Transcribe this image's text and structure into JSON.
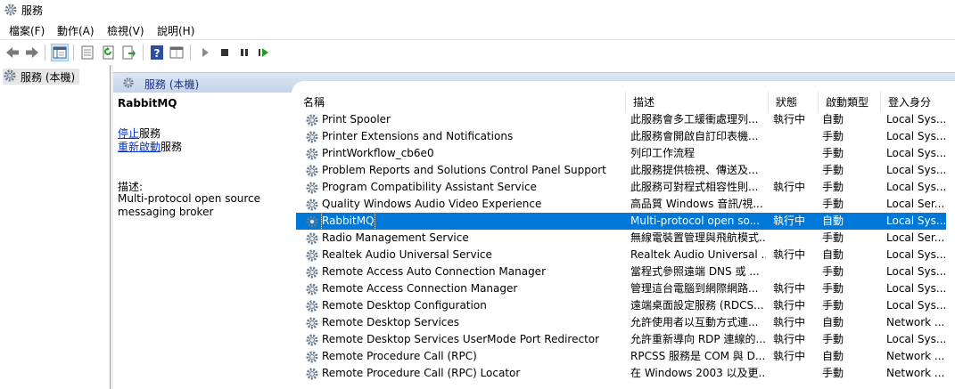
{
  "window": {
    "title": "服務"
  },
  "menu": [
    "檔案(F)",
    "動作(A)",
    "檢視(V)",
    "說明(H)"
  ],
  "tree": {
    "node_label": "服務 (本機)"
  },
  "detail_header": {
    "title": "服務 (本機)"
  },
  "selected_service": {
    "name": "RabbitMQ",
    "stop_link": "停止",
    "stop_suffix": "服務",
    "restart_link": "重新啟動",
    "restart_suffix": "服務",
    "desc_label": "描述:",
    "desc_text": "Multi-protocol open source messaging broker"
  },
  "columns": [
    "名稱",
    "描述",
    "狀態",
    "啟動類型",
    "登入身分"
  ],
  "rows": [
    {
      "name": "Print Spooler",
      "desc": "此服務會多工緩衝處理列...",
      "status": "執行中",
      "startup": "自動",
      "logon": "Local Sys..."
    },
    {
      "name": "Printer Extensions and Notifications",
      "desc": "此服務會開啟自訂印表機...",
      "status": "",
      "startup": "手動",
      "logon": "Local Sys..."
    },
    {
      "name": "PrintWorkflow_cb6e0",
      "desc": "列印工作流程",
      "status": "",
      "startup": "手動",
      "logon": "Local Sys..."
    },
    {
      "name": "Problem Reports and Solutions Control Panel Support",
      "desc": "此服務提供檢視、傳送及...",
      "status": "",
      "startup": "手動",
      "logon": "Local Sys..."
    },
    {
      "name": "Program Compatibility Assistant Service",
      "desc": "此服務可對程式相容性則...",
      "status": "執行中",
      "startup": "手動",
      "logon": "Local Sys..."
    },
    {
      "name": "Quality Windows Audio Video Experience",
      "desc": "高品質 Windows 音訊/視...",
      "status": "",
      "startup": "手動",
      "logon": "Local Ser..."
    },
    {
      "name": "RabbitMQ",
      "desc": "Multi-protocol open so...",
      "status": "執行中",
      "startup": "自動",
      "logon": "Local Sys..."
    },
    {
      "name": "Radio Management Service",
      "desc": "無線電裝置管理與飛航模式...",
      "status": "",
      "startup": "手動",
      "logon": "Local Ser..."
    },
    {
      "name": "Realtek Audio Universal Service",
      "desc": "Realtek Audio Universal ...",
      "status": "執行中",
      "startup": "自動",
      "logon": "Local Sys..."
    },
    {
      "name": "Remote Access Auto Connection Manager",
      "desc": "當程式參照遠端 DNS 或 ...",
      "status": "",
      "startup": "手動",
      "logon": "Local Sys..."
    },
    {
      "name": "Remote Access Connection Manager",
      "desc": "管理這台電腦到網際網路...",
      "status": "執行中",
      "startup": "手動",
      "logon": "Local Sys..."
    },
    {
      "name": "Remote Desktop Configuration",
      "desc": "遠端桌面設定服務 (RDCS...",
      "status": "執行中",
      "startup": "手動",
      "logon": "Local Sys..."
    },
    {
      "name": "Remote Desktop Services",
      "desc": "允許使用者以互動方式連...",
      "status": "執行中",
      "startup": "自動",
      "logon": "Network ..."
    },
    {
      "name": "Remote Desktop Services UserMode Port Redirector",
      "desc": "允許重新導向 RDP 連線的...",
      "status": "執行中",
      "startup": "手動",
      "logon": "Local Sys..."
    },
    {
      "name": "Remote Procedure Call (RPC)",
      "desc": "RPCSS 服務是 COM 與 D...",
      "status": "執行中",
      "startup": "自動",
      "logon": "Network ..."
    },
    {
      "name": "Remote Procedure Call (RPC) Locator",
      "desc": "在 Windows 2003 以及更...",
      "status": "",
      "startup": "手動",
      "logon": "Network ..."
    }
  ],
  "colors": {
    "selection": "#0078d7",
    "header_grad_top": "#dce6f4",
    "header_grad_bottom": "#c3d4ea",
    "link": "#0033cc"
  },
  "icons": [
    "gear-icon",
    "back-arrow-icon",
    "forward-arrow-icon",
    "console-tree-icon",
    "properties-icon",
    "refresh-icon",
    "export-icon",
    "help-icon",
    "view-icon",
    "play-icon",
    "stop-icon",
    "pause-icon",
    "restart-icon",
    "service-gear-icon"
  ]
}
